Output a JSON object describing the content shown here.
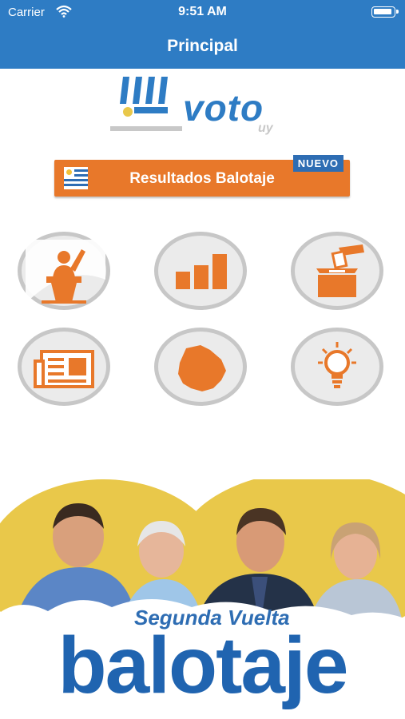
{
  "status_bar": {
    "carrier": "Carrier",
    "time": "9:51 AM"
  },
  "nav": {
    "title": "Principal"
  },
  "logo": {
    "brand": "voto",
    "tld": "uy"
  },
  "banner": {
    "label": "Resultados Balotaje",
    "badge": "NUEVO"
  },
  "menu": [
    {
      "name": "candidates",
      "icon": "speaker-podium-icon"
    },
    {
      "name": "results-chart",
      "icon": "bar-chart-icon"
    },
    {
      "name": "ballot-box",
      "icon": "ballot-box-icon"
    },
    {
      "name": "news",
      "icon": "newspaper-icon"
    },
    {
      "name": "map-uruguay",
      "icon": "uruguay-map-icon"
    },
    {
      "name": "tips",
      "icon": "lightbulb-icon"
    }
  ],
  "promo": {
    "subtitle": "Segunda Vuelta",
    "title": "balotaje"
  },
  "colors": {
    "brand_blue": "#2e7cc4",
    "orange": "#e8782a",
    "promo_yellow": "#e9c84a"
  }
}
